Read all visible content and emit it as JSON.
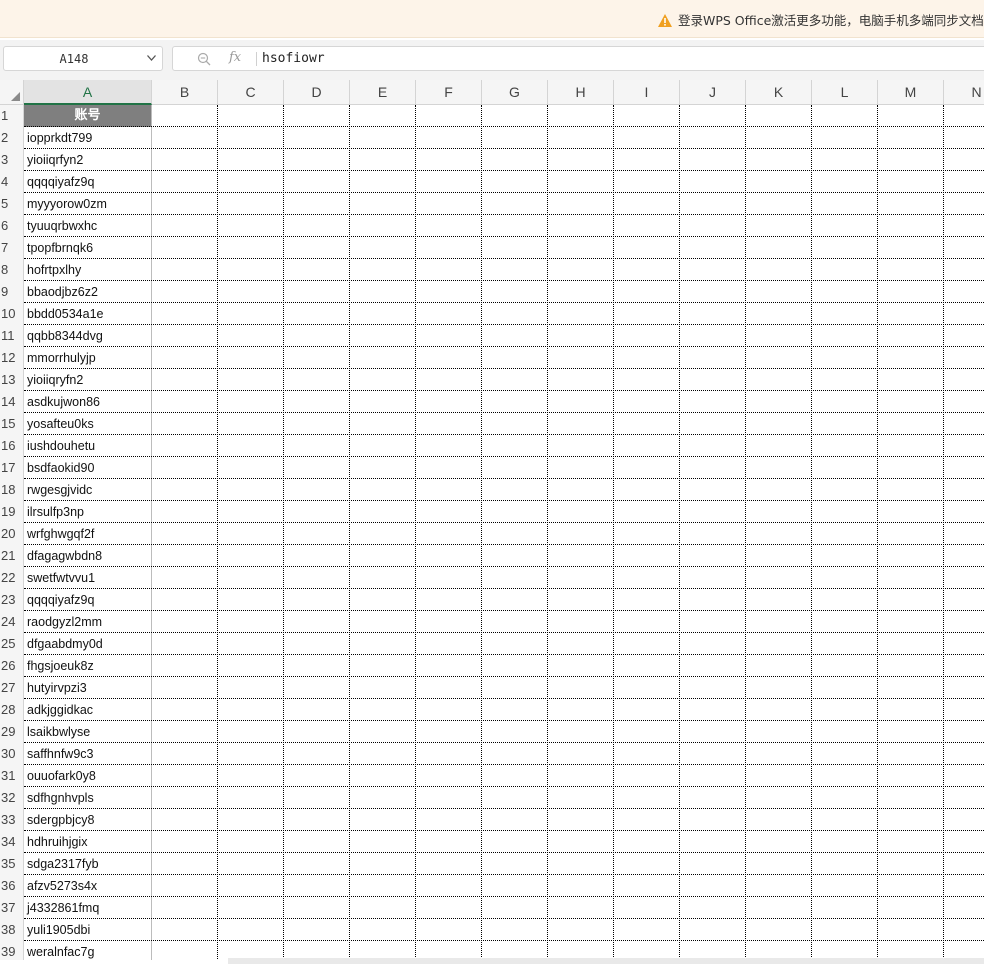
{
  "banner": {
    "message": "登录WPS Office激活更多功能，电脑手机多端同步文档数"
  },
  "namebox": {
    "value": "A148"
  },
  "formula_bar": {
    "fx_label": "fx",
    "value": "hsofiowr"
  },
  "columns": [
    "A",
    "B",
    "C",
    "D",
    "E",
    "F",
    "G",
    "H",
    "I",
    "J",
    "K",
    "L",
    "M",
    "N"
  ],
  "selected_column": "A",
  "header_cell": {
    "row": 1,
    "text": "账号"
  },
  "rows": [
    {
      "n": "1",
      "a": "账号"
    },
    {
      "n": "2",
      "a": "iopprkdt799"
    },
    {
      "n": "3",
      "a": "yioiiqrfyn2"
    },
    {
      "n": "4",
      "a": "qqqqiyafz9q"
    },
    {
      "n": "5",
      "a": "myyyorow0zm"
    },
    {
      "n": "6",
      "a": "tyuuqrbwxhc"
    },
    {
      "n": "7",
      "a": "tpopfbrnqk6"
    },
    {
      "n": "8",
      "a": "hofrtpxlhy"
    },
    {
      "n": "9",
      "a": "bbaodjbz6z2"
    },
    {
      "n": "10",
      "a": "bbdd0534a1e"
    },
    {
      "n": "11",
      "a": "qqbb8344dvg"
    },
    {
      "n": "12",
      "a": "mmorrhulyjp"
    },
    {
      "n": "13",
      "a": "yioiiqryfn2"
    },
    {
      "n": "14",
      "a": "asdkujwon86"
    },
    {
      "n": "15",
      "a": "yosafteu0ks"
    },
    {
      "n": "16",
      "a": "iushdouhetu"
    },
    {
      "n": "17",
      "a": "bsdfaokid90"
    },
    {
      "n": "18",
      "a": "rwgesgjvidc"
    },
    {
      "n": "19",
      "a": "ilrsulfp3np"
    },
    {
      "n": "20",
      "a": "wrfghwgqf2f"
    },
    {
      "n": "21",
      "a": "dfagagwbdn8"
    },
    {
      "n": "22",
      "a": "swetfwtvvu1"
    },
    {
      "n": "23",
      "a": "qqqqiyafz9q"
    },
    {
      "n": "24",
      "a": "raodgyzl2mm"
    },
    {
      "n": "25",
      "a": "dfgaabdmy0d"
    },
    {
      "n": "26",
      "a": "fhgsjoeuk8z"
    },
    {
      "n": "27",
      "a": "hutyirvpzi3"
    },
    {
      "n": "28",
      "a": "adkjggidkac"
    },
    {
      "n": "29",
      "a": "lsaikbwlyse"
    },
    {
      "n": "30",
      "a": "saffhnfw9c3"
    },
    {
      "n": "31",
      "a": "ouuofark0y8"
    },
    {
      "n": "32",
      "a": "sdfhgnhvpls"
    },
    {
      "n": "33",
      "a": "sdergpbjcy8"
    },
    {
      "n": "34",
      "a": "hdhruihjgix"
    },
    {
      "n": "35",
      "a": "sdga2317fyb"
    },
    {
      "n": "36",
      "a": "afzv5273s4x"
    },
    {
      "n": "37",
      "a": "j4332861fmq"
    },
    {
      "n": "38",
      "a": "yuli1905dbi"
    },
    {
      "n": "39",
      "a": "weralnfac7g"
    }
  ],
  "colors": {
    "banner_bg": "#fdf4e9",
    "warning": "#f0a020",
    "header_cell_bg": "#7f7f7f",
    "selected_col_accent": "#217346"
  }
}
